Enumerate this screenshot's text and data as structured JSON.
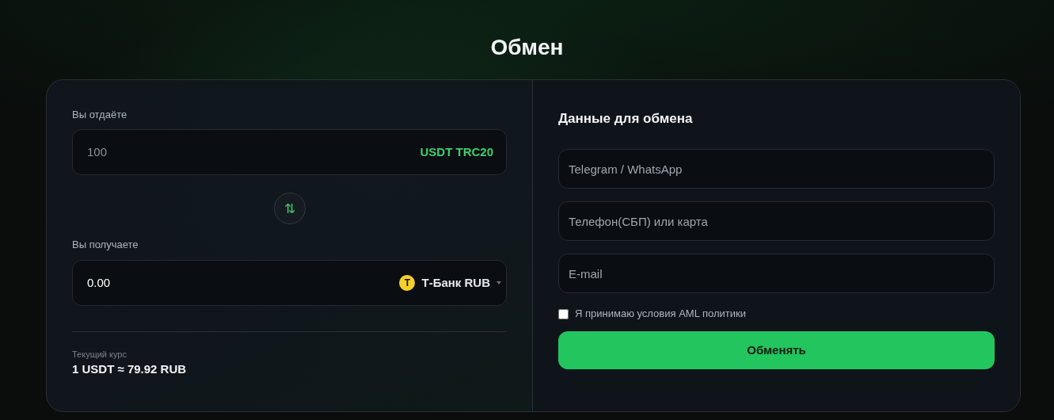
{
  "title": "Обмен",
  "give": {
    "label": "Вы отдаёте",
    "placeholder": "100",
    "currency": "USDT TRC20"
  },
  "swap_button": {
    "icon": "⇅"
  },
  "receive": {
    "label": "Вы получаете",
    "value": "0.00",
    "bank_logo": "T",
    "currency": "Т-Банк RUB"
  },
  "rate": {
    "label": "Текущий курс",
    "value": "1 USDT ≈ 79.92 RUB"
  },
  "details": {
    "title": "Данные для обмена",
    "fields": [
      {
        "placeholder": "Telegram / WhatsApp"
      },
      {
        "placeholder": "Телефон(СБП) или карта"
      },
      {
        "placeholder": "E-mail"
      }
    ],
    "aml": {
      "label": "Я принимаю условия AML политики",
      "checked": false
    },
    "submit": "Обменять"
  }
}
